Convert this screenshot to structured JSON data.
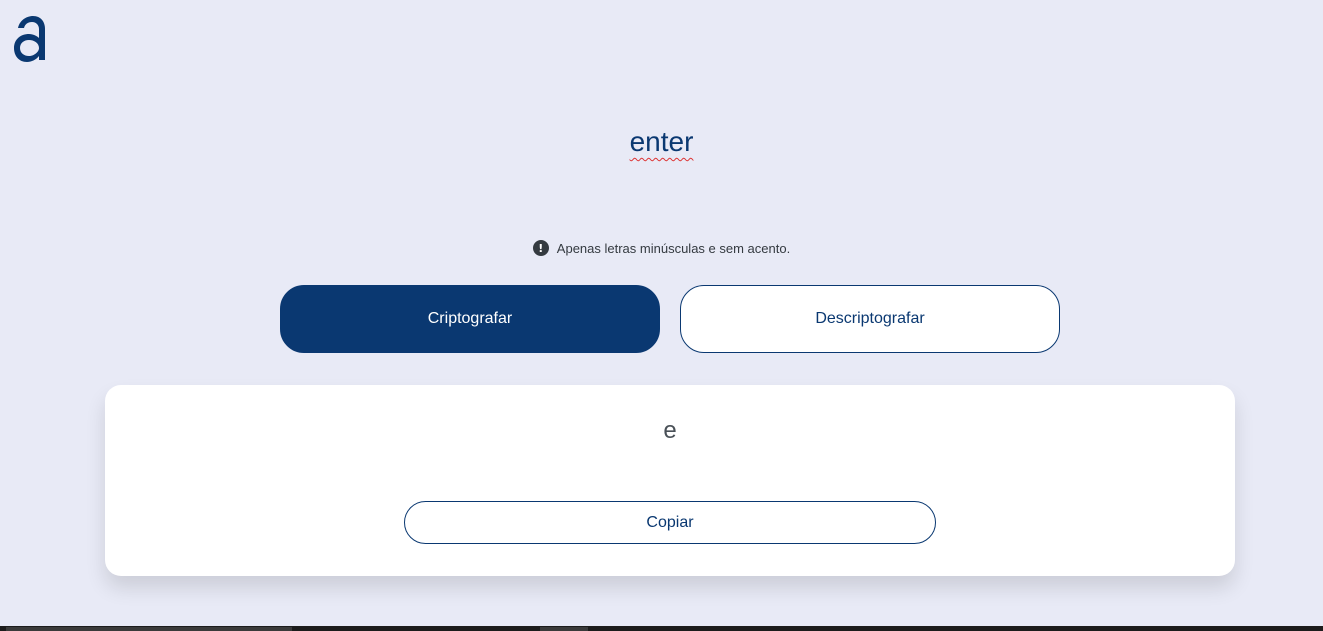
{
  "logo": {
    "icon": "alura-a-logo-icon",
    "color": "#0a3871"
  },
  "input": {
    "text": "enter"
  },
  "hint": {
    "icon": "exclamation-circle-icon",
    "text": "Apenas letras minúsculas e sem acento."
  },
  "buttons": {
    "encrypt_label": "Criptografar",
    "decrypt_label": "Descriptografar"
  },
  "output": {
    "text": "e",
    "copy_label": "Copiar"
  },
  "colors": {
    "background": "#e8eaf6",
    "primary": "#0a3871",
    "card": "#ffffff"
  }
}
